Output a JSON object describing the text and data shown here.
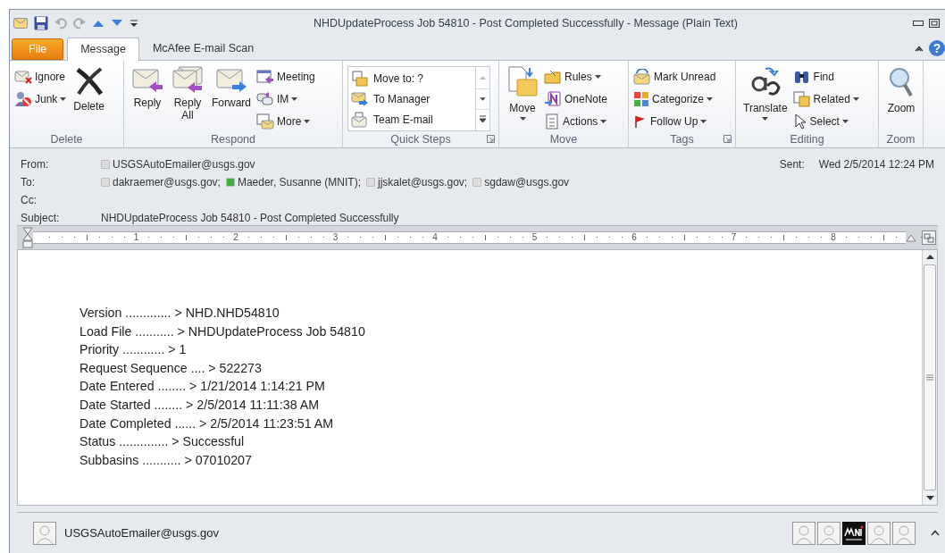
{
  "window": {
    "title": "NHDUpdateProcess Job 54810 - Post Completed Successfully  -  Message (Plain Text)",
    "help": "?"
  },
  "tabs": [
    {
      "label": "File",
      "kind": "file",
      "selected": false
    },
    {
      "label": "Message",
      "kind": "tab",
      "selected": true
    },
    {
      "label": "McAfee E-mail Scan",
      "kind": "tab",
      "selected": false
    }
  ],
  "ribbon": [
    {
      "label": "Delete",
      "launcher": false,
      "buttons": [
        {
          "label": "Ignore",
          "kind": "small",
          "dropdown": false
        },
        {
          "label": "Junk",
          "kind": "small",
          "dropdown": true
        },
        {
          "label": "Delete",
          "kind": "large",
          "dropdown": false
        }
      ]
    },
    {
      "label": "Respond",
      "launcher": false,
      "buttons": [
        {
          "label": "Reply",
          "kind": "large",
          "dropdown": false
        },
        {
          "label": "Reply\nAll",
          "kind": "large",
          "dropdown": false
        },
        {
          "label": "Forward",
          "kind": "large",
          "dropdown": false
        },
        {
          "label": "Meeting",
          "kind": "small",
          "dropdown": false
        },
        {
          "label": "IM",
          "kind": "small",
          "dropdown": true
        },
        {
          "label": "More",
          "kind": "small",
          "dropdown": true
        }
      ]
    },
    {
      "label": "Quick Steps",
      "launcher": true,
      "buttons": [
        {
          "label": "Move to: ?",
          "kind": "gallery",
          "dropdown": false
        },
        {
          "label": "To Manager",
          "kind": "gallery",
          "dropdown": false
        },
        {
          "label": "Team E-mail",
          "kind": "gallery",
          "dropdown": false
        }
      ]
    },
    {
      "label": "Move",
      "launcher": false,
      "buttons": [
        {
          "label": "Move",
          "kind": "large",
          "dropdown": true
        },
        {
          "label": "Rules",
          "kind": "small",
          "dropdown": true
        },
        {
          "label": "OneNote",
          "kind": "small",
          "dropdown": false
        },
        {
          "label": "Actions",
          "kind": "small",
          "dropdown": true
        }
      ]
    },
    {
      "label": "Tags",
      "launcher": true,
      "buttons": [
        {
          "label": "Mark Unread",
          "kind": "small",
          "dropdown": false
        },
        {
          "label": "Categorize",
          "kind": "small",
          "dropdown": true
        },
        {
          "label": "Follow Up",
          "kind": "small",
          "dropdown": true
        }
      ]
    },
    {
      "label": "Editing",
      "launcher": false,
      "buttons": [
        {
          "label": "Translate",
          "kind": "large",
          "dropdown": true
        },
        {
          "label": "Find",
          "kind": "small",
          "dropdown": false
        },
        {
          "label": "Related",
          "kind": "small",
          "dropdown": true
        },
        {
          "label": "Select",
          "kind": "small",
          "dropdown": true
        }
      ]
    },
    {
      "label": "Zoom",
      "launcher": false,
      "buttons": [
        {
          "label": "Zoom",
          "kind": "large",
          "dropdown": false
        }
      ]
    }
  ],
  "header": {
    "from_label": "From:",
    "from": {
      "name": "USGSAutoEmailer@usgs.gov",
      "color": "#dcdcdc"
    },
    "to_label": "To:",
    "to": [
      {
        "name": "dakraemer@usgs.gov;",
        "color": "#dcdcdc"
      },
      {
        "name": "Maeder, Susanne (MNIT);",
        "color": "#3cb043"
      },
      {
        "name": "jjskalet@usgs.gov;",
        "color": "#dcdcdc"
      },
      {
        "name": "sgdaw@usgs.gov",
        "color": "#dcdcdc"
      }
    ],
    "cc_label": "Cc:",
    "subject_label": "Subject:",
    "subject": "NHDUpdateProcess Job 54810 - Post Completed Successfully",
    "sent_label": "Sent:",
    "sent": "Wed 2/5/2014 12:24 PM"
  },
  "ruler": [
    "1",
    "2",
    "3",
    "4",
    "5",
    "6",
    "7",
    "8"
  ],
  "body": [
    "Version ............. > NHD.NHD54810",
    "Load File ........... > NHDUpdateProcess Job 54810",
    "Priority ............ > 1",
    "Request Sequence .... > 522273",
    "Date Entered ........ > 1/21/2014 1:14:21 PM",
    "Date Started ........ > 2/5/2014 11:11:38 AM",
    "Date Completed ...... > 2/5/2014 11:23:51 AM",
    "Status .............. > Successful",
    "Subbasins ........... > 07010207"
  ],
  "people_pane": {
    "name": "USGSAutoEmailer@usgs.gov",
    "contacts": [
      {
        "kind": "person"
      },
      {
        "kind": "person"
      },
      {
        "kind": "logo"
      },
      {
        "kind": "person"
      },
      {
        "kind": "person"
      }
    ]
  }
}
